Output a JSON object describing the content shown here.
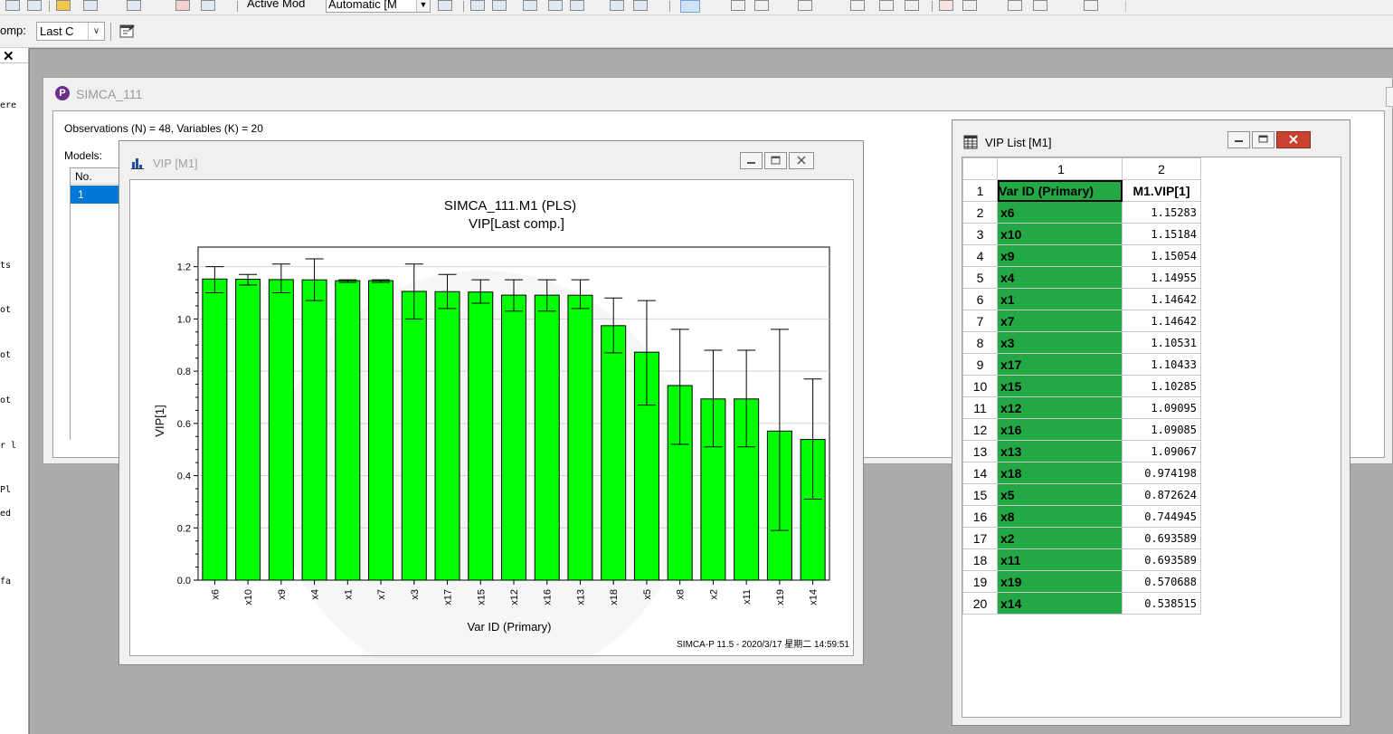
{
  "toolbar": {
    "active_model_label": "Active Mod",
    "active_model_value": "Automatic [M",
    "comp_label": "omp:",
    "comp_value": "Last C"
  },
  "left_panel": {
    "fragments": [
      "ere",
      "ts",
      "ot",
      "ot",
      "ot",
      "r l",
      "Pl",
      "ed",
      "fa"
    ]
  },
  "project": {
    "title": "SIMCA_111",
    "observations_text": "Observations (N) = 48, Variables (K) = 20",
    "models_label": "Models:",
    "models_column": "No.",
    "models_rows": [
      "1"
    ]
  },
  "vip_window": {
    "title": "VIP [M1]",
    "footer": "SIMCA-P 11.5 - 2020/3/17 星期二 14:59:51"
  },
  "chart_data": {
    "type": "bar",
    "title": "SIMCA_111.M1 (PLS)",
    "subtitle": "VIP[Last comp.]",
    "xlabel": "Var ID (Primary)",
    "ylabel": "VIP[1]",
    "ylim": [
      0,
      1.2
    ],
    "yticks": [
      "0.0",
      "0.2",
      "0.4",
      "0.6",
      "0.8",
      "1.0",
      "1.2"
    ],
    "bar_color": "#00ff00",
    "categories": [
      "x6",
      "x10",
      "x9",
      "x4",
      "x1",
      "x7",
      "x3",
      "x17",
      "x15",
      "x12",
      "x16",
      "x13",
      "x18",
      "x5",
      "x8",
      "x2",
      "x11",
      "x19",
      "x14"
    ],
    "values": [
      1.15283,
      1.15184,
      1.15054,
      1.14955,
      1.14642,
      1.14642,
      1.10531,
      1.10433,
      1.10285,
      1.09095,
      1.09085,
      1.09067,
      0.974198,
      0.872624,
      0.744945,
      0.693589,
      0.693589,
      0.570688,
      0.538515
    ],
    "error_low": [
      1.1,
      1.13,
      1.1,
      1.07,
      1.14,
      1.14,
      1.0,
      1.04,
      1.06,
      1.03,
      1.03,
      1.04,
      0.87,
      0.67,
      0.52,
      0.51,
      0.51,
      0.19,
      0.31
    ],
    "error_high": [
      1.2,
      1.17,
      1.21,
      1.23,
      1.15,
      1.15,
      1.21,
      1.17,
      1.15,
      1.15,
      1.15,
      1.15,
      1.08,
      1.07,
      0.96,
      0.88,
      0.88,
      0.96,
      0.77
    ],
    "grid": true
  },
  "vip_list": {
    "title": "VIP List [M1]",
    "col_headers": [
      "1",
      "2"
    ],
    "header_row": [
      "Var ID (Primary)",
      "M1.VIP[1]"
    ],
    "rows": [
      [
        "2",
        "x6",
        "1.15283"
      ],
      [
        "3",
        "x10",
        "1.15184"
      ],
      [
        "4",
        "x9",
        "1.15054"
      ],
      [
        "5",
        "x4",
        "1.14955"
      ],
      [
        "6",
        "x1",
        "1.14642"
      ],
      [
        "7",
        "x7",
        "1.14642"
      ],
      [
        "8",
        "x3",
        "1.10531"
      ],
      [
        "9",
        "x17",
        "1.10433"
      ],
      [
        "10",
        "x15",
        "1.10285"
      ],
      [
        "11",
        "x12",
        "1.09095"
      ],
      [
        "12",
        "x16",
        "1.09085"
      ],
      [
        "13",
        "x13",
        "1.09067"
      ],
      [
        "14",
        "x18",
        "0.974198"
      ],
      [
        "15",
        "x5",
        "0.872624"
      ],
      [
        "16",
        "x8",
        "0.744945"
      ],
      [
        "17",
        "x2",
        "0.693589"
      ],
      [
        "18",
        "x11",
        "0.693589"
      ],
      [
        "19",
        "x19",
        "0.570688"
      ],
      [
        "20",
        "x14",
        "0.538515"
      ]
    ]
  },
  "colors": {
    "mdi_background": "#ababab",
    "list_cell_green": "#22a845",
    "selection_blue": "#0078d7",
    "close_button_red": "#c9422f"
  }
}
